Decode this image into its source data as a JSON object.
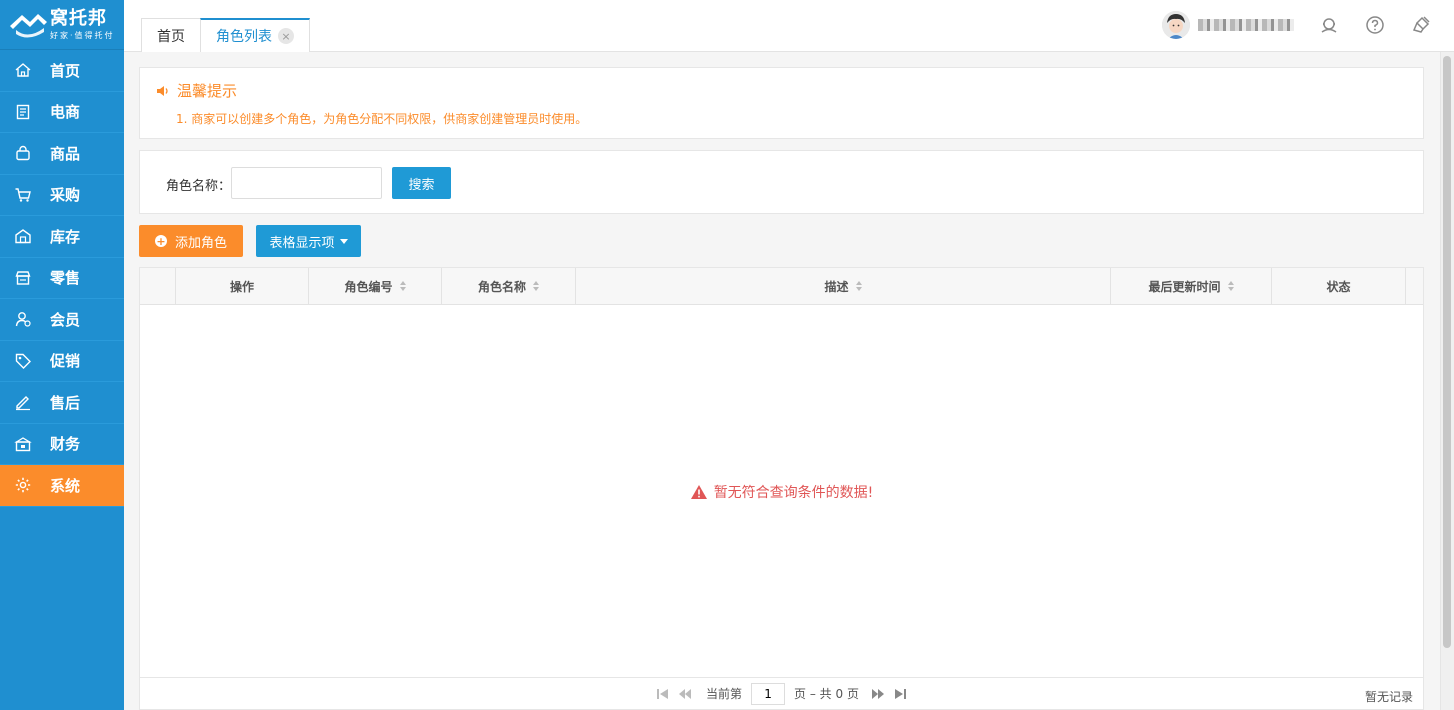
{
  "brand": {
    "title": "窝托邦",
    "subtitle": "好家·值得托付"
  },
  "sidebar": {
    "items": [
      {
        "label": "首页",
        "icon": "home-icon"
      },
      {
        "label": "电商",
        "icon": "document-icon"
      },
      {
        "label": "商品",
        "icon": "bag-icon"
      },
      {
        "label": "采购",
        "icon": "cart-icon"
      },
      {
        "label": "库存",
        "icon": "warehouse-icon"
      },
      {
        "label": "零售",
        "icon": "store-icon"
      },
      {
        "label": "会员",
        "icon": "member-icon"
      },
      {
        "label": "促销",
        "icon": "tag-icon"
      },
      {
        "label": "售后",
        "icon": "pen-icon"
      },
      {
        "label": "财务",
        "icon": "finance-icon"
      },
      {
        "label": "系统",
        "icon": "gear-icon",
        "active": true
      }
    ]
  },
  "tabs": [
    {
      "label": "首页"
    },
    {
      "label": "角色列表",
      "active": true,
      "close": "×"
    }
  ],
  "tips": {
    "title": "温馨提示",
    "line1": "1. 商家可以创建多个角色，为角色分配不同权限，供商家创建管理员时使用。"
  },
  "search": {
    "label": "角色名称：",
    "input_value": "",
    "button": "搜索"
  },
  "actions": {
    "add_label": "添加角色",
    "columns_label": "表格显示项"
  },
  "table": {
    "columns": [
      "操作",
      "角色编号",
      "角色名称",
      "描述",
      "最后更新时间",
      "状态"
    ],
    "empty_message": "暂无符合查询条件的数据!"
  },
  "pager": {
    "prefix": "当前第",
    "current_page": "1",
    "suffix": "页 – 共 0 页",
    "records": "暂无记录"
  },
  "colors": {
    "sidebar": "#1f8fd0",
    "accent": "#fb8c2b",
    "primary_button": "#1f9ad6",
    "empty_text": "#e05656"
  }
}
